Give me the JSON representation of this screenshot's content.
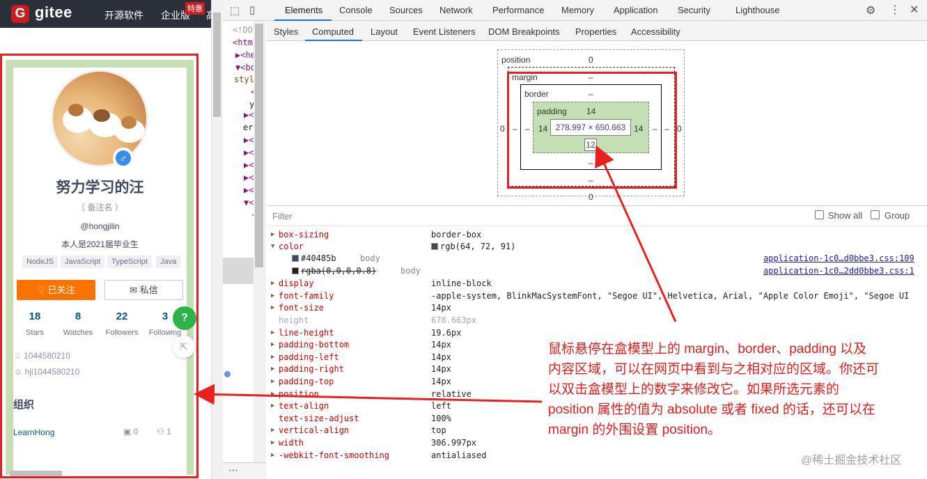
{
  "gitee": {
    "logo_letter": "G",
    "brand": "gitee",
    "nav": [
      "开源软件",
      "企业版",
      "高"
    ],
    "badge": "特惠"
  },
  "profile": {
    "name": "努力学习的汪",
    "remark": "（ 备注名 ）",
    "handle": "@hongjilin",
    "bio": "本人是2021届毕业生",
    "tags": [
      "NodeJS",
      "JavaScript",
      "TypeScript",
      "Java"
    ],
    "follow_label": "♡  已关注",
    "message_label": "✉  私信",
    "stats": [
      {
        "num": "18",
        "label": "Stars"
      },
      {
        "num": "8",
        "label": "Watches"
      },
      {
        "num": "22",
        "label": "Followers"
      },
      {
        "num": "3",
        "label": "Following"
      }
    ],
    "qq": "1044580210",
    "wechat": "hjl1044580210",
    "org_title": "组织",
    "org_name": "LearnHong",
    "org_repos": "0",
    "org_members": "1",
    "help": "?"
  },
  "devtools": {
    "tabs": [
      "Elements",
      "Console",
      "Sources",
      "Network",
      "Performance",
      "Memory",
      "Application",
      "Security",
      "Lighthouse"
    ],
    "subtabs": [
      "Styles",
      "Computed",
      "Layout",
      "Event Listeners",
      "DOM Breakpoints",
      "Properties",
      "Accessibility"
    ],
    "dom_lines": [
      "<!DO",
      "<htm",
      "▶<he",
      "▼<bo",
      "styl",
      "<",
      "y",
      "▶<",
      "er",
      "▶<",
      "▶<",
      "▶<",
      "▶<",
      "▶<",
      "▼<",
      "<"
    ],
    "box_model": {
      "position_label": "position",
      "position_top": "0",
      "position_left": "0",
      "position_right": "0",
      "position_bottom": "0",
      "margin_label": "margin",
      "margin_top": "–",
      "margin_left": "–",
      "margin_right": "–",
      "margin_bottom": "–",
      "border_label": "border",
      "border_top": "–",
      "border_left": "–",
      "border_right": "–",
      "border_bottom": "–",
      "padding_label": "padding",
      "padding_top": "14",
      "padding_left": "14",
      "padding_right": "14",
      "padding_bottom": "12",
      "content": "278.997 × 650.663"
    },
    "filter_placeholder": "Filter",
    "show_all": "Show all",
    "group": "Group",
    "properties": [
      {
        "arrow": "▶",
        "name": "box-sizing",
        "value": "border-box"
      },
      {
        "arrow": "▼",
        "name": "color",
        "value": "rgb(64, 72, 91)",
        "swatch": true
      },
      {
        "arrow": "▶",
        "name": "display",
        "value": "inline-block"
      },
      {
        "arrow": "▶",
        "name": "font-family",
        "value": "-apple-system, BlinkMacSystemFont, \"Segoe UI\", Helvetica, Arial, \"Apple Color Emoji\", \"Segoe UI"
      },
      {
        "arrow": "▶",
        "name": "font-size",
        "value": "14px"
      },
      {
        "arrow": "",
        "name": "height",
        "value": "678.663px",
        "dim": true
      },
      {
        "arrow": "▶",
        "name": "line-height",
        "value": "19.6px"
      },
      {
        "arrow": "▶",
        "name": "padding-bottom",
        "value": "14px"
      },
      {
        "arrow": "▶",
        "name": "padding-left",
        "value": "14px"
      },
      {
        "arrow": "▶",
        "name": "padding-right",
        "value": "14px"
      },
      {
        "arrow": "▶",
        "name": "padding-top",
        "value": "14px"
      },
      {
        "arrow": "▶",
        "name": "position",
        "value": "relative"
      },
      {
        "arrow": "▶",
        "name": "text-align",
        "value": "left"
      },
      {
        "arrow": "",
        "name": "text-size-adjust",
        "value": "100%"
      },
      {
        "arrow": "▶",
        "name": "vertical-align",
        "value": "top"
      },
      {
        "arrow": "▶",
        "name": "width",
        "value": "306.997px"
      },
      {
        "arrow": "▶",
        "name": "-webkit-font-smoothing",
        "value": "antialiased"
      }
    ],
    "color_sub": [
      {
        "value": "#40485b",
        "selector": "body",
        "source": "application-1c0…d0bbe3.css:109"
      },
      {
        "value": "rgba(0,0,0,0.8)",
        "selector": "body",
        "source": "application-1c0…2dd0bbe3.css:1"
      }
    ],
    "more": "⋯"
  },
  "annotation": [
    "鼠标悬停在盒模型上的 margin、border、padding 以及",
    "内容区域，可以在网页中看到与之相对应的区域。你还可",
    "以双击盒模型上的数字来修改它。如果所选元素的",
    "position 属性的值为 absolute 或者 fixed 的话，还可以在",
    "margin 的外围设置 position。"
  ],
  "watermark": "@稀土掘金技术社区",
  "colors": {
    "accent": "#e8201e",
    "brand": "#c71d23",
    "follow": "#fe7300"
  }
}
